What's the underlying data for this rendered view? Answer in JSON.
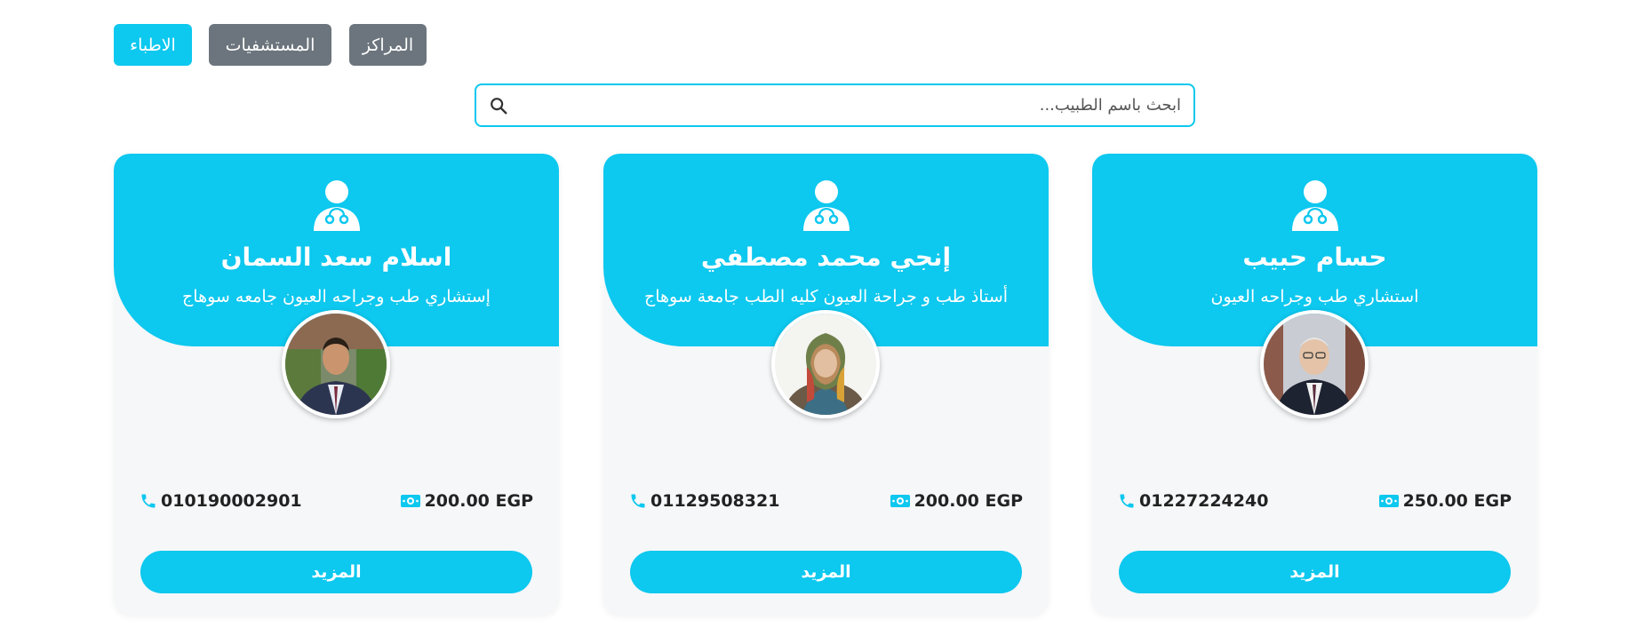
{
  "filters": {
    "doctors_label": "الاطباء",
    "hospitals_label": "المستشفيات",
    "centers_label": "المراكز"
  },
  "search": {
    "placeholder": "ابحث باسم الطبيب..."
  },
  "colors": {
    "accent": "#0dc8ef",
    "secondary": "#6c757d",
    "card_bg": "#f5f7f9"
  },
  "icons": {
    "doctor": "doctor-icon",
    "phone": "phone-icon",
    "money": "money-icon",
    "search": "search-icon"
  },
  "doctors": [
    {
      "name": "حسام حبيب",
      "title": "استشاري طب وجراحه العيون",
      "phone": "01227224240",
      "price": "250.00 EGP",
      "more_label": "المزيد"
    },
    {
      "name": "إنجي محمد مصطفي",
      "title": "أستاذ طب و جراحة العيون كليه الطب جامعة سوهاج",
      "phone": "01129508321",
      "price": "200.00 EGP",
      "more_label": "المزيد"
    },
    {
      "name": "اسلام سعد السمان",
      "title": "إستشاري طب وجراحه العيون جامعه سوهاج",
      "phone": "010190002901",
      "price": "200.00 EGP",
      "more_label": "المزيد"
    }
  ]
}
